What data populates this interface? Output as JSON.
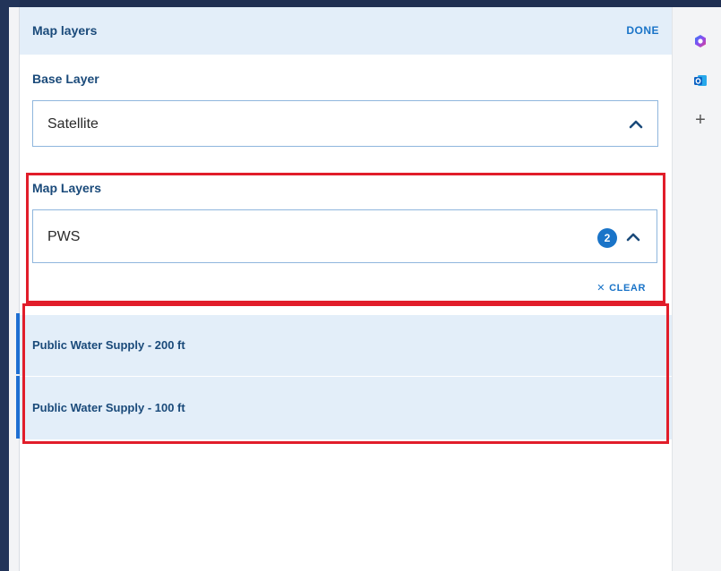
{
  "panel": {
    "title": "Map layers",
    "done_label": "DONE"
  },
  "base_layer": {
    "label": "Base Layer",
    "value": "Satellite"
  },
  "map_layers": {
    "label": "Map Layers",
    "value": "PWS",
    "selected_count": "2",
    "clear_label": "CLEAR",
    "options": [
      {
        "label": "Public Water Supply - 200 ft"
      },
      {
        "label": "Public Water Supply - 100 ft"
      }
    ]
  },
  "side_rail": {
    "icons": [
      "copilot-icon",
      "outlook-icon",
      "plus-icon"
    ],
    "plus_glyph": "+"
  },
  "colors": {
    "accent": "#1a74c8",
    "highlight": "#e11d2a",
    "header_bg": "#e3eef9"
  }
}
